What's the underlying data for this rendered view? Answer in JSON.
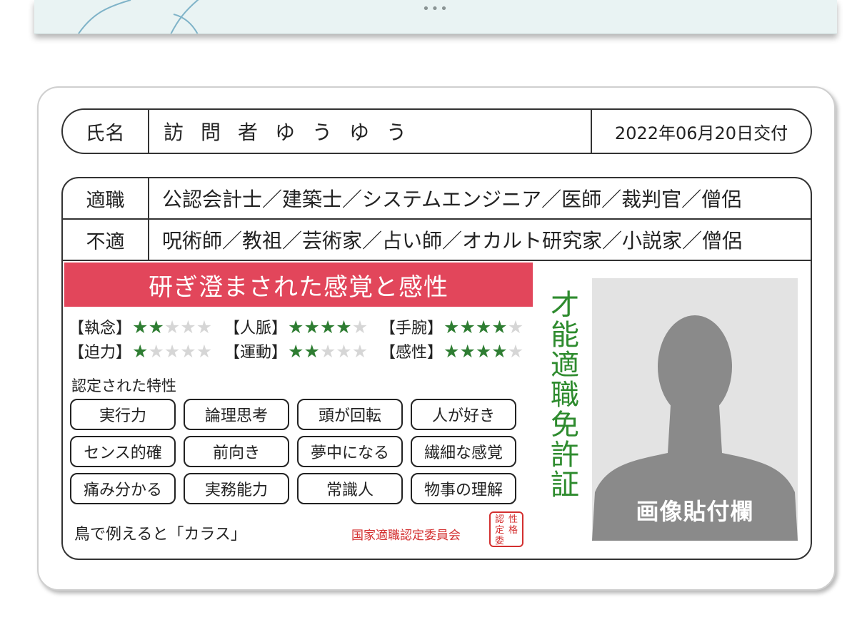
{
  "banner": {
    "more_icon": "more-dots-icon"
  },
  "card": {
    "name_label": "氏名",
    "name_value": "訪問者ゆうゆう",
    "issue_date": "2022年06月20日交付",
    "suitable_label": "適職",
    "suitable_jobs": "公認会計士／建築士／システムエンジニア／医師／裁判官／僧侶",
    "unsuitable_label": "不適",
    "unsuitable_jobs": "呪術師／教祖／芸術家／占い師／オカルト研究家／小説家／僧侶",
    "headline": "研ぎ澄まされた感覚と感性",
    "stats": [
      {
        "label": "【執念】",
        "rating": 2,
        "max": 5
      },
      {
        "label": "【人脈】",
        "rating": 4,
        "max": 5
      },
      {
        "label": "【手腕】",
        "rating": 4,
        "max": 5
      },
      {
        "label": "【迫力】",
        "rating": 1,
        "max": 5
      },
      {
        "label": "【運動】",
        "rating": 2,
        "max": 5
      },
      {
        "label": "【感性】",
        "rating": 4,
        "max": 5
      }
    ],
    "traits_title": "認定された特性",
    "traits": [
      "実行力",
      "論理思考",
      "頭が回転",
      "人が好き",
      "センス的確",
      "前向き",
      "夢中になる",
      "繊細な感覚",
      "痛み分かる",
      "実務能力",
      "常識人",
      "物事の理解"
    ],
    "bird": "鳥で例えると「カラス」",
    "committee": "国家適職認定委員会",
    "seal_chars": [
      "認",
      "性",
      "定",
      "格",
      "委",
      ""
    ],
    "vertical_title": "才能適職免許証",
    "photo_label": "画像貼付欄",
    "colors": {
      "headline_bg": "#e2465b",
      "star_on": "#2e7d32",
      "star_off": "#d6d6d6",
      "title_green": "#2e8b2e",
      "seal_red": "#d32f2f"
    }
  }
}
